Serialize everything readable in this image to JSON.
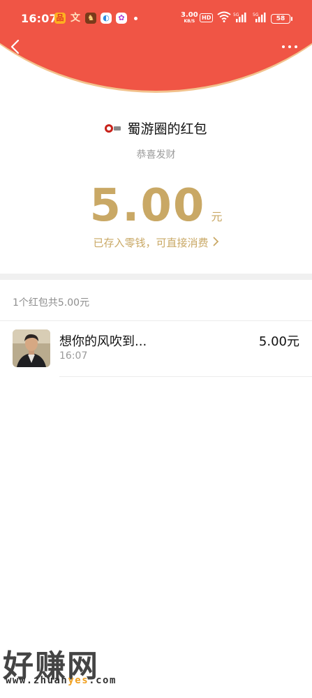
{
  "status_bar": {
    "time": "16:07",
    "net_speed": "3.00",
    "net_unit": "KB/S",
    "hd": "HD",
    "signal1": "5G",
    "signal2": "5G",
    "battery": "58"
  },
  "colors": {
    "header_red": "#f05545",
    "gold": "#c9a865",
    "header_border": "#f2c28d"
  },
  "nav": {
    "back_icon": "chevron-left-icon",
    "more_icon": "more-dots-icon"
  },
  "red_packet": {
    "sender_name": "蜀游圈的红包",
    "wish": "恭喜发财",
    "amount": "5.00",
    "unit": "元",
    "stored_note": "已存入零钱，可直接消费",
    "summary": "1个红包共5.00元"
  },
  "records": [
    {
      "name": "想你的风吹到...",
      "time": "16:07",
      "amount": "5.00元"
    }
  ],
  "watermark": {
    "title": "好赚网",
    "url_prefix": "www.zhuan",
    "url_highlight": "yes",
    "url_suffix": ".com"
  }
}
